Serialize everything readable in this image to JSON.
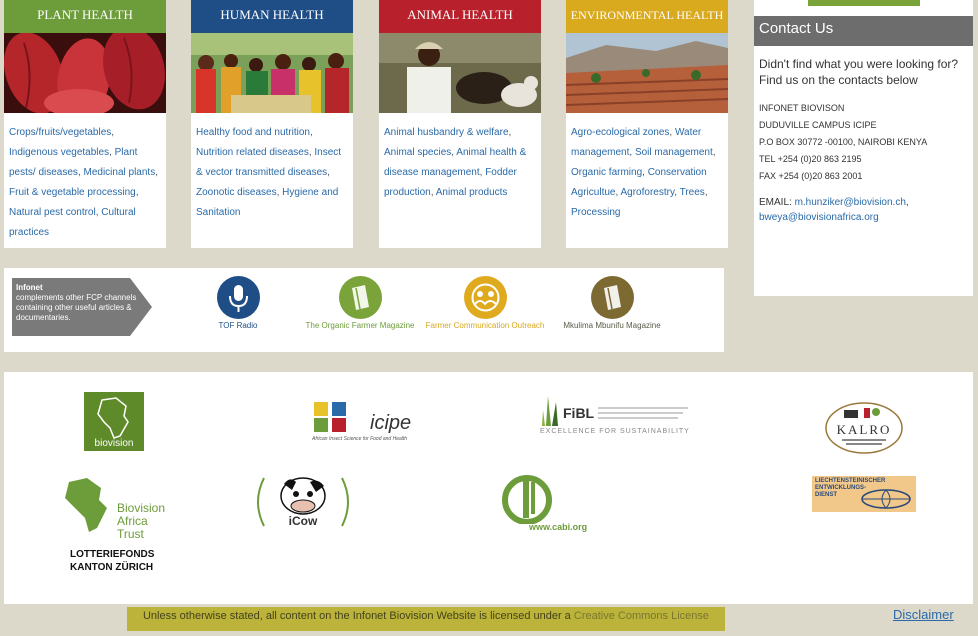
{
  "cards": [
    {
      "title": "PLANT HEALTH",
      "color": "#6d9c3a",
      "image": "cocoa-pods-image",
      "links": [
        "Crops/fruits/vegetables",
        "Indigenous vegetables",
        "Plant pests/ diseases",
        "Medicinal plants",
        "Fruit & vegetable processing",
        "Natural pest control",
        "Cultural practices"
      ]
    },
    {
      "title": "HUMAN HEALTH",
      "color": "#1f4e87",
      "image": "market-crowd-image",
      "links": [
        "Healthy food and nutrition",
        "Nutrition related diseases",
        "Insect & vector transmitted diseases",
        "Zoonotic diseases",
        "Hygiene and Sanitation"
      ]
    },
    {
      "title": "ANIMAL HEALTH",
      "color": "#b8202b",
      "image": "farmer-with-goats-image",
      "links": [
        "Animal husbandry & welfare",
        "Animal species",
        "Animal health & disease management",
        "Fodder production",
        "Animal products"
      ]
    },
    {
      "title": "ENVIRONMENTAL HEALTH",
      "color": "#d9a91e",
      "image": "terraced-landscape-image",
      "links": [
        "Agro-ecological zones",
        "Water management",
        "Soil management",
        "Organic farming",
        "Conservation Agricultue",
        "Agroforestry",
        "Trees",
        "Processing"
      ]
    }
  ],
  "contact": {
    "title": "Contact Us",
    "intro": "Didn't find what you were looking for? Find us on the contacts below",
    "address": [
      "INFONET BIOVISON",
      "DUDUVILLE CAMPUS ICIPE",
      "P.O BOX 30772 -00100, NAIROBI KENYA",
      "TEL +254 (0)20 863 2195",
      "FAX +254 (0)20 863 2001"
    ],
    "email_label": "EMAIL:",
    "email1": "m.hunziker@biovision.ch",
    "email2": "bweya@biovisionafrica.org"
  },
  "channels": {
    "intro_title": "Infonet",
    "intro_text": "complements other FCP channels containing other useful articles & documentaries.",
    "items": [
      {
        "label": "TOF Radio",
        "color": "#1f4e87",
        "text_color": "#1f4e87",
        "icon": "microphone-icon"
      },
      {
        "label": "The Organic Farmer Magazine",
        "color": "#7aa33a",
        "text_color": "#6d9c3a",
        "icon": "magazine-icon"
      },
      {
        "label": "Farmer Communication Outreach",
        "color": "#e0aa1e",
        "text_color": "#d9a91e",
        "icon": "people-icon"
      },
      {
        "label": "Mkulima Mbunifu Magazine",
        "color": "#7d6a33",
        "text_color": "#5b5b4a",
        "icon": "magazine-icon"
      }
    ]
  },
  "partners": [
    {
      "name": "biovision",
      "text": "biovision"
    },
    {
      "name": "icipe",
      "text": "icipe",
      "sub": "African Insect Science for Food and Health"
    },
    {
      "name": "fibl",
      "text": "FiBL",
      "sub": "EXCELLENCE FOR SUSTAINABILITY"
    },
    {
      "name": "kalro",
      "text": "KALRO"
    },
    {
      "name": "biovision-africa-trust",
      "text1": "Biovision",
      "text2": "Africa",
      "text3": "Trust"
    },
    {
      "name": "lotteriefonds",
      "text1": "LOTTERIEFONDS",
      "text2": "KANTON ZÜRICH"
    },
    {
      "name": "icow",
      "text": "iCow"
    },
    {
      "name": "cabi",
      "text": "www.cabi.org"
    },
    {
      "name": "led",
      "text1": "LIECHTENSTEINISCHER",
      "text2": "ENTWICKLUNGS-",
      "text3": "DIENST"
    }
  ],
  "footer": {
    "text": "Unless otherwise stated, all content on the Infonet Biovision Website is licensed under a",
    "link": "Creative Commons License",
    "disclaimer": "Disclaimer"
  }
}
